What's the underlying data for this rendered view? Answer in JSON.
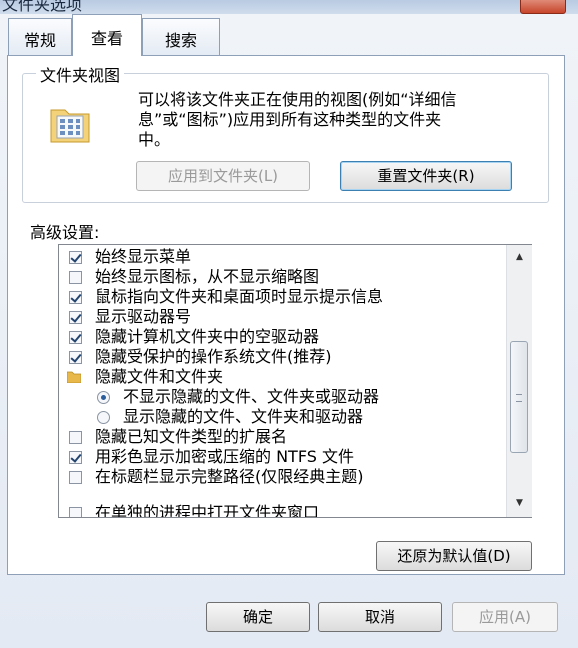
{
  "window": {
    "title": "文件夹选项"
  },
  "tabs": [
    {
      "label": "常规",
      "active": false
    },
    {
      "label": "查看",
      "active": true
    },
    {
      "label": "搜索",
      "active": false
    }
  ],
  "folder_views": {
    "legend": "文件夹视图",
    "description_lines": [
      "可以将该文件夹正在使用的视图(例如“详细信",
      "息”或“图标”)应用到所有这种类型的文件夹",
      "中。"
    ],
    "apply_button": "应用到文件夹(L)",
    "reset_button": "重置文件夹(R)"
  },
  "advanced": {
    "label": "高级设置:",
    "items": [
      {
        "type": "checkbox",
        "checked": true,
        "indent": 0,
        "label": "始终显示菜单"
      },
      {
        "type": "checkbox",
        "checked": false,
        "indent": 0,
        "label": "始终显示图标，从不显示缩略图"
      },
      {
        "type": "checkbox",
        "checked": true,
        "indent": 0,
        "label": "鼠标指向文件夹和桌面项时显示提示信息"
      },
      {
        "type": "checkbox",
        "checked": true,
        "indent": 0,
        "label": "显示驱动器号"
      },
      {
        "type": "checkbox",
        "checked": true,
        "indent": 0,
        "label": "隐藏计算机文件夹中的空驱动器"
      },
      {
        "type": "checkbox",
        "checked": true,
        "indent": 0,
        "label": "隐藏受保护的操作系统文件(推荐)"
      },
      {
        "type": "folder",
        "indent": 0,
        "label": "隐藏文件和文件夹"
      },
      {
        "type": "radio",
        "selected": true,
        "indent": 1,
        "label": "不显示隐藏的文件、文件夹或驱动器"
      },
      {
        "type": "radio",
        "selected": false,
        "indent": 1,
        "label": "显示隐藏的文件、文件夹和驱动器"
      },
      {
        "type": "checkbox",
        "checked": false,
        "indent": 0,
        "label": "隐藏已知文件类型的扩展名"
      },
      {
        "type": "checkbox",
        "checked": true,
        "indent": 0,
        "label": "用彩色显示加密或压缩的 NTFS 文件"
      },
      {
        "type": "checkbox",
        "checked": false,
        "indent": 0,
        "label": "在标题栏显示完整路径(仅限经典主题)"
      },
      {
        "type": "checkbox",
        "checked": false,
        "indent": 0,
        "label": "在单独的进程中打开文件夹窗口"
      }
    ],
    "restore_defaults_button": "还原为默认值(D)"
  },
  "footer": {
    "ok_button": "确定",
    "cancel_button": "取消",
    "apply_button": "应用(A)"
  },
  "colors": {
    "accent": "#3c7fb1",
    "check": "#22446f",
    "folder": "#e8b84a"
  }
}
